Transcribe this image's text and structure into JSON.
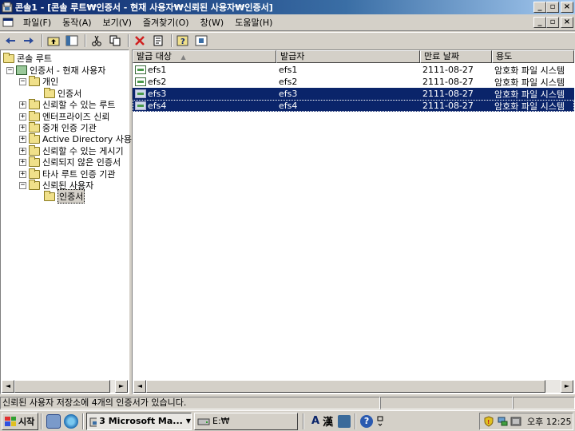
{
  "window": {
    "title": "콘솔1 - [콘솔 루트₩인증서 - 현재 사용자₩신뢰된 사용자₩인증서]"
  },
  "menu": {
    "items": [
      "파일(F)",
      "동작(A)",
      "보기(V)",
      "즐겨찾기(O)",
      "창(W)",
      "도움말(H)"
    ]
  },
  "tree": {
    "items": [
      {
        "label": "콘솔 루트"
      },
      {
        "label": "인증서 - 현재 사용자"
      },
      {
        "label": "개인"
      },
      {
        "label": "인증서"
      },
      {
        "label": "신뢰할 수 있는 루트"
      },
      {
        "label": "엔터프라이즈 신뢰"
      },
      {
        "label": "중개 인증 기관"
      },
      {
        "label": "Active Directory 사용"
      },
      {
        "label": "신뢰할 수 있는 게시기"
      },
      {
        "label": "신뢰되지 않은 인증서"
      },
      {
        "label": "타사 루트 인증 기관"
      },
      {
        "label": "신뢰된 사용자"
      },
      {
        "label": "인증서"
      }
    ]
  },
  "list": {
    "columns": [
      "발급 대상",
      "발급자",
      "만료 날짜",
      "용도"
    ],
    "rows": [
      {
        "issued_to": "efs1",
        "issued_by": "efs1",
        "expires": "2111-08-27",
        "purpose": "암호화 파일 시스템"
      },
      {
        "issued_to": "efs2",
        "issued_by": "efs2",
        "expires": "2111-08-27",
        "purpose": "암호화 파일 시스템"
      },
      {
        "issued_to": "efs3",
        "issued_by": "efs3",
        "expires": "2111-08-27",
        "purpose": "암호화 파일 시스템"
      },
      {
        "issued_to": "efs4",
        "issued_by": "efs4",
        "expires": "2111-08-27",
        "purpose": "암호화 파일 시스템"
      }
    ]
  },
  "status": {
    "text": "신뢰된 사용자 저장소에 4개의 인증서가 있습니다."
  },
  "taskbar": {
    "start_label": "시작",
    "tasks": [
      "3 Microsoft Ma...",
      "E:₩"
    ],
    "tray_lang": "A",
    "tray_hanja": "漢",
    "clock": "오후 12:25"
  },
  "colors": {
    "selection": "#0a246a",
    "titlebar": "#0a246a",
    "face": "#d4d0c8"
  }
}
